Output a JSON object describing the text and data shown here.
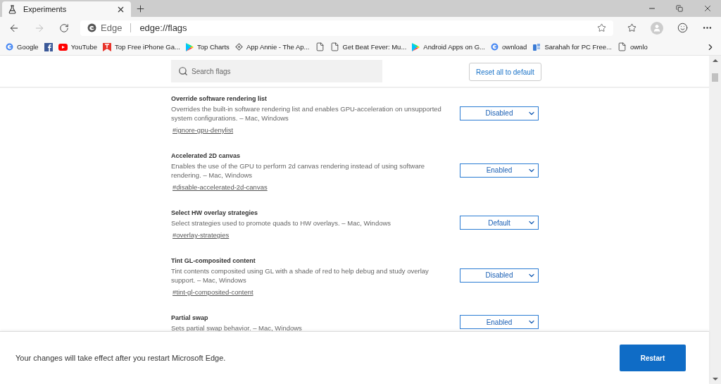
{
  "tab": {
    "title": "Experiments",
    "selected": true
  },
  "address": {
    "site": "Edge",
    "url": "edge://flags"
  },
  "bookmarks": [
    {
      "kind": "google",
      "label": "Google"
    },
    {
      "kind": "facebook"
    },
    {
      "kind": "youtube",
      "label": "YouTube"
    },
    {
      "kind": "red",
      "label": "Top Free iPhone Ga..."
    },
    {
      "kind": "play",
      "label": "Top Charts"
    },
    {
      "kind": "annie",
      "label": "App Annie - The Ap..."
    },
    {
      "kind": "page"
    },
    {
      "kind": "page",
      "label": "Get Beat Fever: Mu..."
    },
    {
      "kind": "play",
      "label": "Android Apps on G..."
    },
    {
      "kind": "google",
      "label": "ownload"
    },
    {
      "kind": "sarahah",
      "label": "Sarahah for PC Free..."
    },
    {
      "kind": "page",
      "label": "ownlo"
    }
  ],
  "search": {
    "placeholder": "Search flags"
  },
  "reset_button": "Reset all to default",
  "flags": [
    {
      "title": "Override software rendering list",
      "description": "Overrides the built-in software rendering list and enables GPU-acceleration on unsupported system configurations. – Mac, Windows",
      "link": "#ignore-gpu-denylist",
      "value": "Disabled"
    },
    {
      "title": "Accelerated 2D canvas",
      "description": "Enables the use of the GPU to perform 2d canvas rendering instead of using software rendering. – Mac, Windows",
      "link": "#disable-accelerated-2d-canvas",
      "value": "Enabled"
    },
    {
      "title": "Select HW overlay strategies",
      "description": "Select strategies used to promote quads to HW overlays. – Mac, Windows",
      "link": "#overlay-strategies",
      "value": "Default"
    },
    {
      "title": "Tint GL-composited content",
      "description": "Tint contents composited using GL with a shade of red to help debug and study overlay support. – Mac, Windows",
      "link": "#tint-gl-composited-content",
      "value": "Disabled"
    },
    {
      "title": "Partial swap",
      "description": "Sets partial swap behavior. – Mac, Windows",
      "value": "Enabled"
    }
  ],
  "footer": {
    "message": "Your changes will take effect after you restart Microsoft Edge.",
    "button": "Restart"
  }
}
